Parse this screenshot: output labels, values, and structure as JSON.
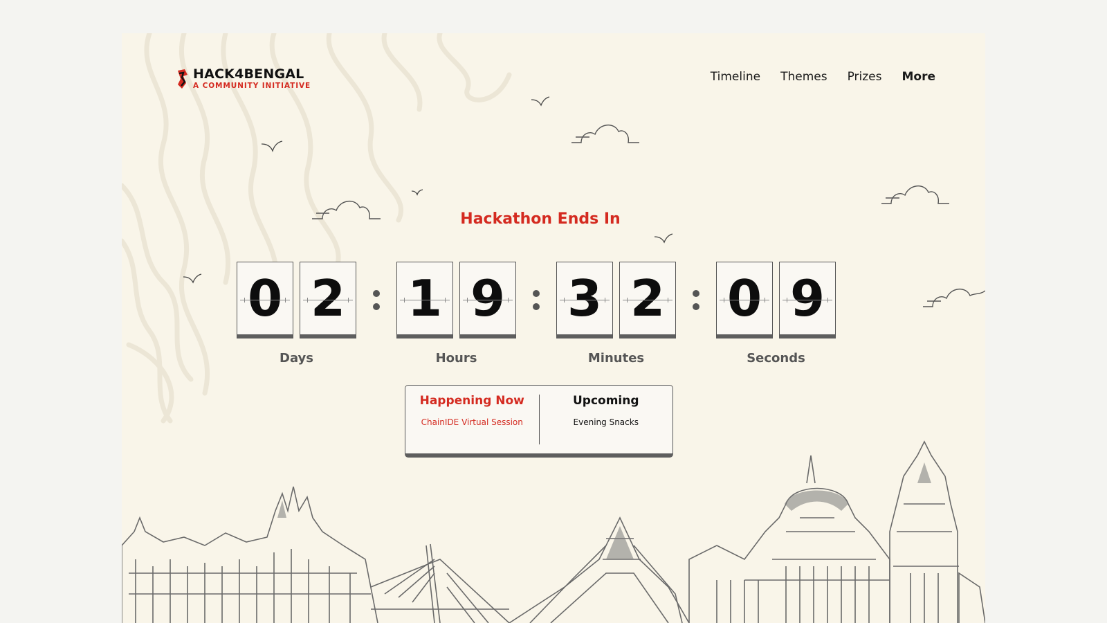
{
  "brand": {
    "name": "HACK4BENGAL",
    "tagline": "A COMMUNITY INITIATIVE",
    "accent_color": "#d42a20"
  },
  "nav": {
    "items": [
      "Timeline",
      "Themes",
      "Prizes",
      "More"
    ]
  },
  "countdown": {
    "title": "Hackathon Ends In",
    "units": [
      {
        "label": "Days",
        "digits": [
          "0",
          "2"
        ]
      },
      {
        "label": "Hours",
        "digits": [
          "1",
          "9"
        ]
      },
      {
        "label": "Minutes",
        "digits": [
          "3",
          "2"
        ]
      },
      {
        "label": "Seconds",
        "digits": [
          "0",
          "9"
        ]
      }
    ]
  },
  "events": {
    "now": {
      "heading": "Happening Now",
      "item": "ChainIDE Virtual Session"
    },
    "next": {
      "heading": "Upcoming",
      "item": "Evening Snacks"
    }
  },
  "icons": {
    "logo": "hack4bengal-logo-icon",
    "decorations": [
      "contour-lines",
      "cloud-icon",
      "bird-icon",
      "kolkata-skyline-illustration"
    ]
  }
}
